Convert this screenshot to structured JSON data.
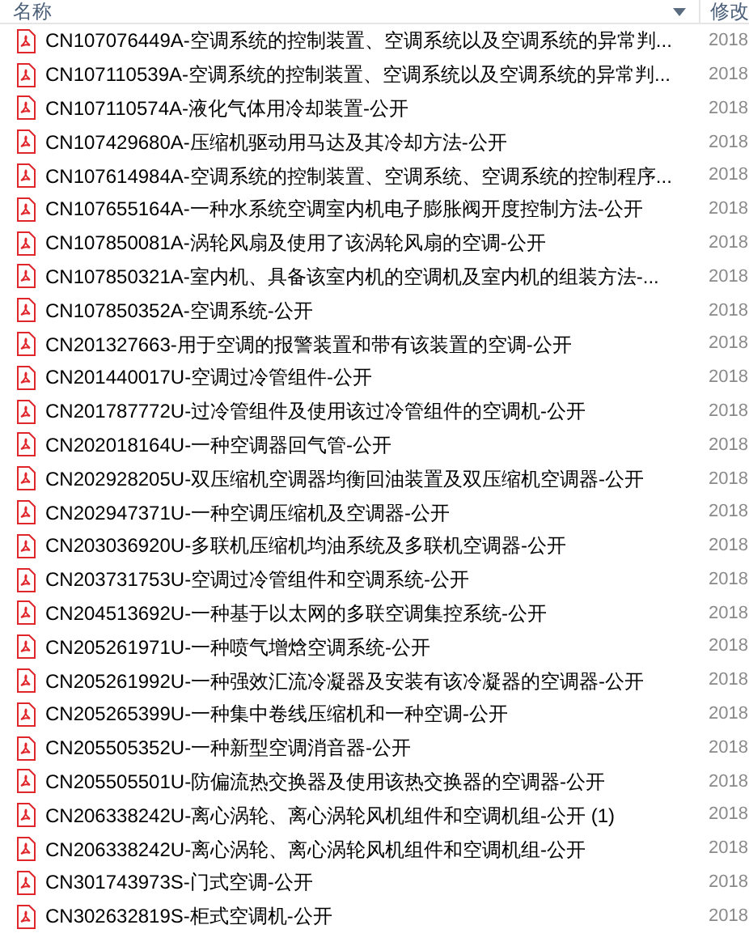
{
  "columns": [
    {
      "label": "名称"
    },
    {
      "label": "修改"
    }
  ],
  "files": [
    {
      "name": "CN107076449A-空调系统的控制装置、空调系统以及空调系统的异常判...",
      "modified": "2018"
    },
    {
      "name": "CN107110539A-空调系统的控制装置、空调系统以及空调系统的异常判...",
      "modified": "2018"
    },
    {
      "name": "CN107110574A-液化气体用冷却装置-公开",
      "modified": "2018"
    },
    {
      "name": "CN107429680A-压缩机驱动用马达及其冷却方法-公开",
      "modified": "2018"
    },
    {
      "name": "CN107614984A-空调系统的控制装置、空调系统、空调系统的控制程序...",
      "modified": "2018"
    },
    {
      "name": "CN107655164A-一种水系统空调室内机电子膨胀阀开度控制方法-公开",
      "modified": "2018"
    },
    {
      "name": "CN107850081A-涡轮风扇及使用了该涡轮风扇的空调-公开",
      "modified": "2018"
    },
    {
      "name": "CN107850321A-室内机、具备该室内机的空调机及室内机的组装方法-...",
      "modified": "2018"
    },
    {
      "name": "CN107850352A-空调系统-公开",
      "modified": "2018"
    },
    {
      "name": "CN201327663-用于空调的报警装置和带有该装置的空调-公开",
      "modified": "2018"
    },
    {
      "name": "CN201440017U-空调过冷管组件-公开",
      "modified": "2018"
    },
    {
      "name": "CN201787772U-过冷管组件及使用该过冷管组件的空调机-公开",
      "modified": "2018"
    },
    {
      "name": "CN202018164U-一种空调器回气管-公开",
      "modified": "2018"
    },
    {
      "name": "CN202928205U-双压缩机空调器均衡回油装置及双压缩机空调器-公开",
      "modified": "2018"
    },
    {
      "name": "CN202947371U-一种空调压缩机及空调器-公开",
      "modified": "2018"
    },
    {
      "name": "CN203036920U-多联机压缩机均油系统及多联机空调器-公开",
      "modified": "2018"
    },
    {
      "name": "CN203731753U-空调过冷管组件和空调系统-公开",
      "modified": "2018"
    },
    {
      "name": "CN204513692U-一种基于以太网的多联空调集控系统-公开",
      "modified": "2018"
    },
    {
      "name": "CN205261971U-一种喷气增焓空调系统-公开",
      "modified": "2018"
    },
    {
      "name": "CN205261992U-一种强效汇流冷凝器及安装有该冷凝器的空调器-公开",
      "modified": "2018"
    },
    {
      "name": "CN205265399U-一种集中卷线压缩机和一种空调-公开",
      "modified": "2018"
    },
    {
      "name": "CN205505352U-一种新型空调消音器-公开",
      "modified": "2018"
    },
    {
      "name": "CN205505501U-防偏流热交换器及使用该热交换器的空调器-公开",
      "modified": "2018"
    },
    {
      "name": "CN206338242U-离心涡轮、离心涡轮风机组件和空调机组-公开 (1)",
      "modified": "2018"
    },
    {
      "name": "CN206338242U-离心涡轮、离心涡轮风机组件和空调机组-公开",
      "modified": "2018"
    },
    {
      "name": "CN301743973S-门式空调-公开",
      "modified": "2018"
    },
    {
      "name": "CN302632819S-柜式空调机-公开",
      "modified": "2018"
    }
  ]
}
